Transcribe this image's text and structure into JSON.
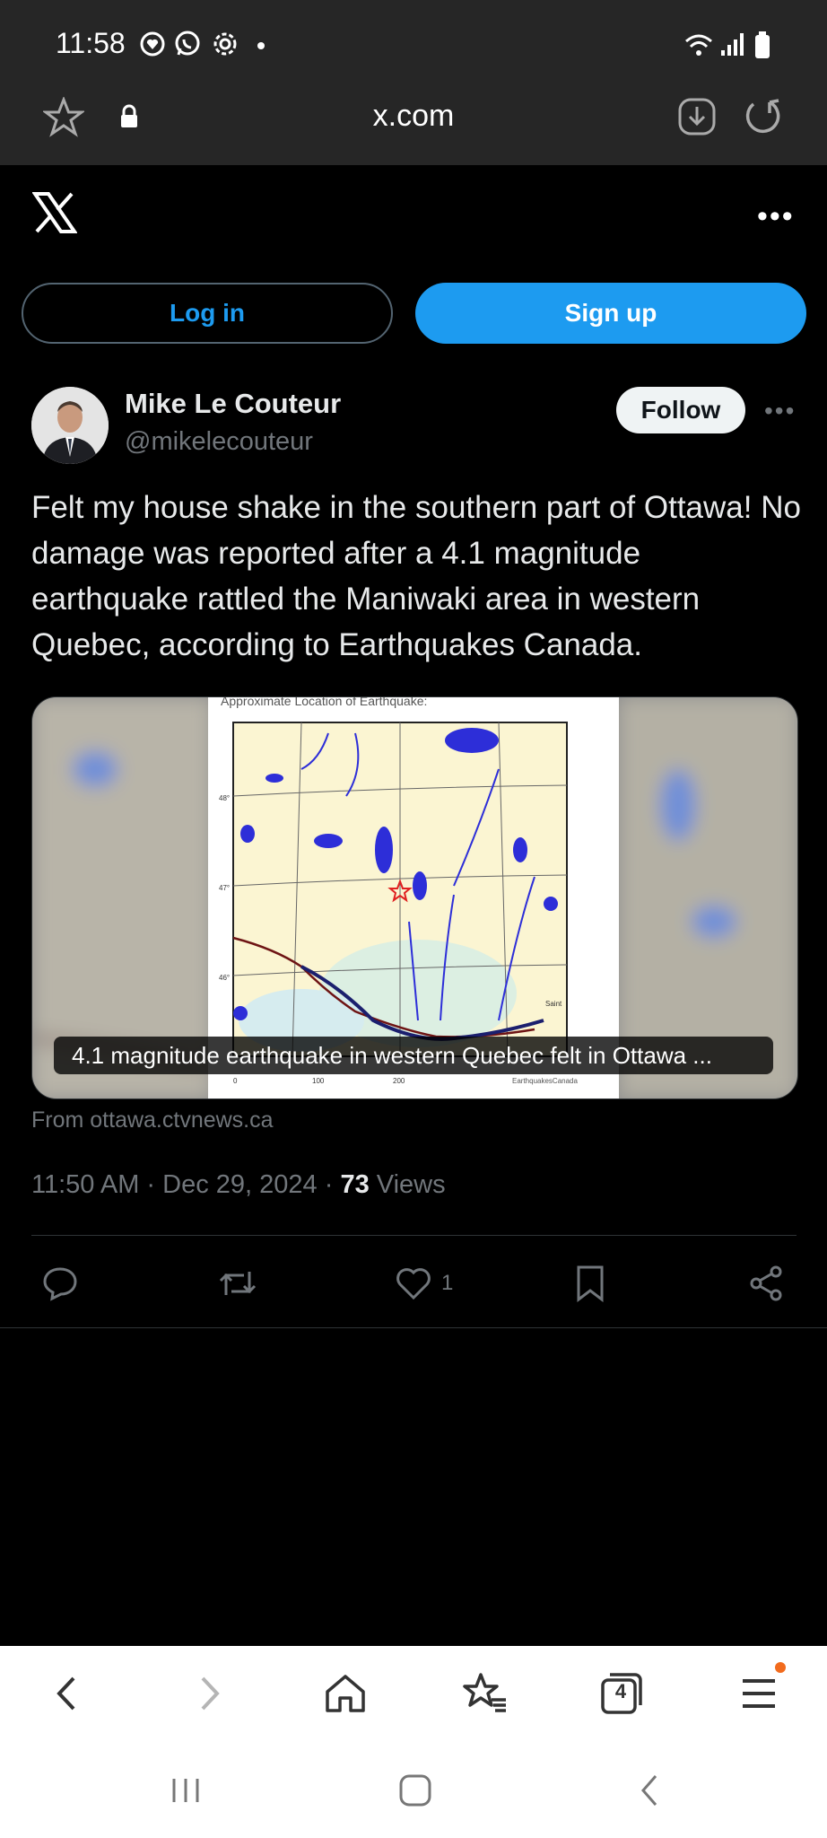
{
  "status": {
    "time": "11:58"
  },
  "browser": {
    "url": "x.com"
  },
  "auth": {
    "login_label": "Log in",
    "signup_label": "Sign up"
  },
  "post": {
    "author_name": "Mike Le Couteur",
    "author_handle": "@mikelecouteur",
    "follow_label": "Follow",
    "text": "Felt my house shake in the southern part of Ottawa! No damage was reported after a 4.1 magnitude earthquake rattled the Maniwaki area in western Quebec, according to Earthquakes Canada.",
    "card": {
      "map_title": "Approximate Location of Earthquake:",
      "map_lat_labels": [
        "48°",
        "47°",
        "46°"
      ],
      "map_scale_labels": [
        "0",
        "100",
        "200"
      ],
      "map_credit": "EarthquakesCanada",
      "map_place": "Saint",
      "caption": "4.1 magnitude earthquake in western Quebec felt in Ottawa ...",
      "source": "From ottawa.ctvnews.ca"
    },
    "timestamp": "11:50 AM · Dec 29, 2024 · ",
    "views_count": "73",
    "views_label": " Views",
    "like_count": "1"
  },
  "colors": {
    "accent": "#1d9bf0",
    "background": "#000000",
    "chrome": "#262626"
  },
  "bottom_nav": {
    "tabs_count": "4"
  }
}
